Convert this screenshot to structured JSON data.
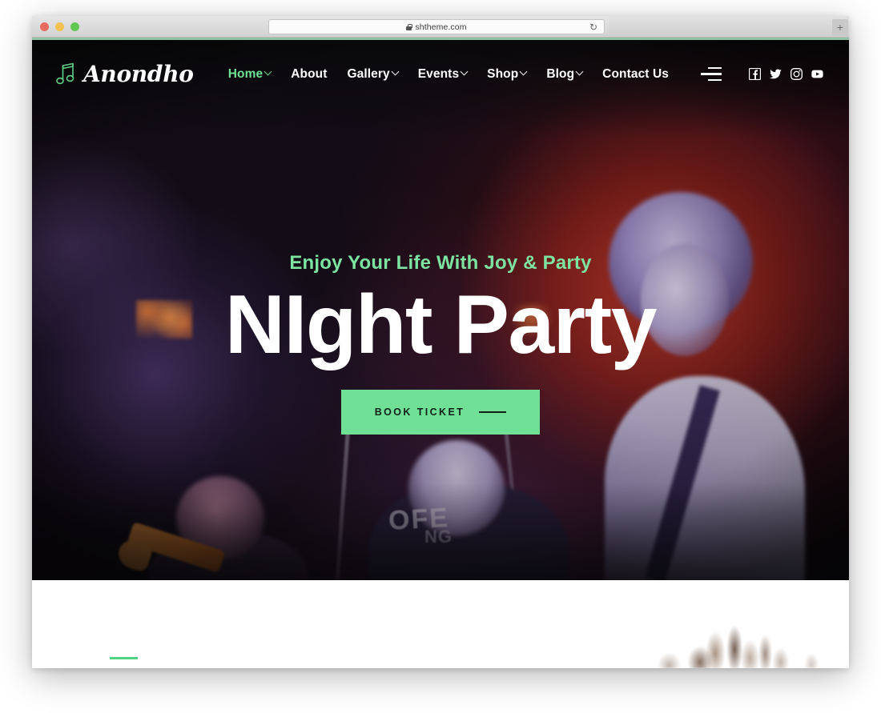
{
  "browser": {
    "url": "shtheme.com",
    "lock_icon": "lock-icon",
    "reload_icon": "↻",
    "new_tab_label": "+",
    "traffic_lights": [
      "close-red",
      "minimize-yellow",
      "maximize-green"
    ]
  },
  "header": {
    "logo_text": "Anondho",
    "logo_icon": "music-note-icon",
    "menu_icon": "hamburger-menu-icon",
    "nav": [
      {
        "label": "Home",
        "has_dropdown": true,
        "active": true
      },
      {
        "label": "About",
        "has_dropdown": false,
        "active": false
      },
      {
        "label": "Gallery",
        "has_dropdown": true,
        "active": false
      },
      {
        "label": "Events",
        "has_dropdown": true,
        "active": false
      },
      {
        "label": "Shop",
        "has_dropdown": true,
        "active": false
      },
      {
        "label": "Blog",
        "has_dropdown": true,
        "active": false
      },
      {
        "label": "Contact Us",
        "has_dropdown": false,
        "active": false
      }
    ],
    "socials": [
      {
        "name": "facebook-icon"
      },
      {
        "name": "twitter-icon"
      },
      {
        "name": "instagram-icon"
      },
      {
        "name": "youtube-icon"
      }
    ]
  },
  "hero": {
    "subtitle": "Enjoy Your Life With Joy & Party",
    "title": "NIght Party",
    "cta_label": "BOOK TICKET",
    "shirt_text_1": "OFE",
    "shirt_text_2": "NG"
  },
  "colors": {
    "accent_green": "#6fe096",
    "subtitle_green": "#7de3a0",
    "rule_green": "#4fd483",
    "hero_dark": "#101012",
    "chrome_accent": "#8fc2a6"
  }
}
